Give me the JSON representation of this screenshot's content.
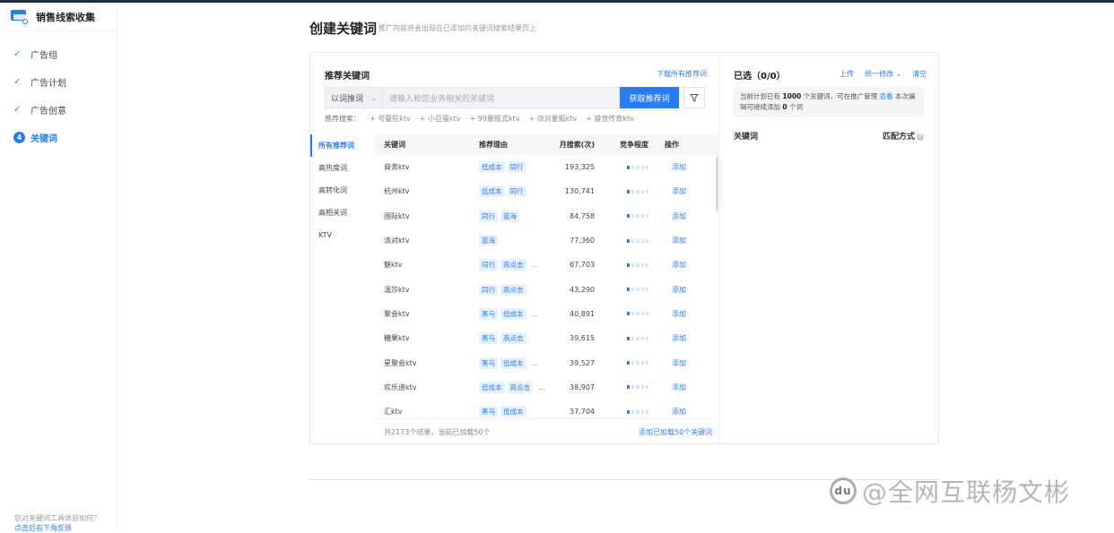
{
  "brand": {
    "title": "销售线索收集"
  },
  "sidebar": {
    "steps": [
      {
        "label": "广告组",
        "state": "done"
      },
      {
        "label": "广告计划",
        "state": "done"
      },
      {
        "label": "广告创意",
        "state": "done"
      },
      {
        "label": "关键词",
        "state": "active",
        "number": "4"
      }
    ],
    "feedback_text": "您对关键词工具体验如何？",
    "feedback_link": "点击后右下角反馈"
  },
  "page": {
    "title": "创建关键词",
    "subtitle": "推广内容将会出现在已添加的关键词搜索结果页上"
  },
  "recommend": {
    "title": "推荐关键词",
    "download_link": "下载所有推荐词",
    "search_mode": "以词推词",
    "search_placeholder": "请输入和您业务相关的关键词",
    "get_button": "获取推荐词",
    "rec_search_label": "推荐搜索：",
    "rec_search_items": [
      "+ 号曼陀ktv",
      "+ 小巨蛋ktv",
      "+ 99量贩式ktv",
      "+ 派对量贩ktv",
      "+ 盛世传奇ktv"
    ],
    "categories": [
      "所有推荐词",
      "高热度词",
      "高转化词",
      "高相关词",
      "KTV"
    ],
    "columns": {
      "keyword": "关键词",
      "reason": "推荐理由",
      "monthly": "月搜索(次)",
      "competition": "竞争程度",
      "action": "操作"
    },
    "rows": [
      {
        "keyword": "商务ktv",
        "tags": [
          "低成本",
          "同行"
        ],
        "more": false,
        "monthly": "193,325",
        "level": 1,
        "action": "添加"
      },
      {
        "keyword": "杭州ktv",
        "tags": [
          "低成本",
          "同行"
        ],
        "more": false,
        "monthly": "130,741",
        "level": 1,
        "action": "添加"
      },
      {
        "keyword": "国际ktv",
        "tags": [
          "同行",
          "蓝海"
        ],
        "more": false,
        "monthly": "84,758",
        "level": 1,
        "action": "添加"
      },
      {
        "keyword": "派对ktv",
        "tags": [
          "蓝海"
        ],
        "more": false,
        "monthly": "77,360",
        "level": 1,
        "action": "添加"
      },
      {
        "keyword": "魅ktv",
        "tags": [
          "同行",
          "高点击"
        ],
        "more": true,
        "monthly": "67,703",
        "level": 1,
        "action": "添加"
      },
      {
        "keyword": "温莎ktv",
        "tags": [
          "同行",
          "高点击"
        ],
        "more": false,
        "monthly": "43,290",
        "level": 1,
        "action": "添加"
      },
      {
        "keyword": "聚会ktv",
        "tags": [
          "黑马",
          "低成本"
        ],
        "more": true,
        "monthly": "40,891",
        "level": 1,
        "action": "添加"
      },
      {
        "keyword": "糖果ktv",
        "tags": [
          "黑马",
          "高点击"
        ],
        "more": false,
        "monthly": "39,615",
        "level": 1,
        "action": "添加"
      },
      {
        "keyword": "星聚会ktv",
        "tags": [
          "黑马",
          "低成本"
        ],
        "more": true,
        "monthly": "39,527",
        "level": 1,
        "action": "添加"
      },
      {
        "keyword": "欢乐迪ktv",
        "tags": [
          "低成本",
          "高点击"
        ],
        "more": true,
        "monthly": "38,907",
        "level": 1,
        "action": "添加"
      },
      {
        "keyword": "汇ktv",
        "tags": [
          "黑马",
          "低成本"
        ],
        "more": false,
        "monthly": "37,704",
        "level": 1,
        "action": "添加"
      }
    ],
    "footer_count": "共2173个结果，当前已加载50个",
    "footer_add": "添加已加载50个关键词"
  },
  "selected": {
    "title": "已选（0/0）",
    "upload": "上传",
    "batch_edit": "统一修改",
    "clear": "清空",
    "notice_pre": "当前计划已有",
    "notice_count": "1000",
    "notice_mid": "个关键词，可在推广管理",
    "notice_link": "查看",
    "notice_post": "本次编辑可继续添加",
    "notice_remain": "0",
    "notice_end": "个词",
    "col_keyword": "关键词",
    "col_match": "匹配方式"
  },
  "footer": {
    "watermark": "@全网互联杨文彬",
    "watermark_badge": "du"
  },
  "colors": {
    "accent": "#2a7cf3",
    "tag_bg": "#e6f0fe"
  }
}
